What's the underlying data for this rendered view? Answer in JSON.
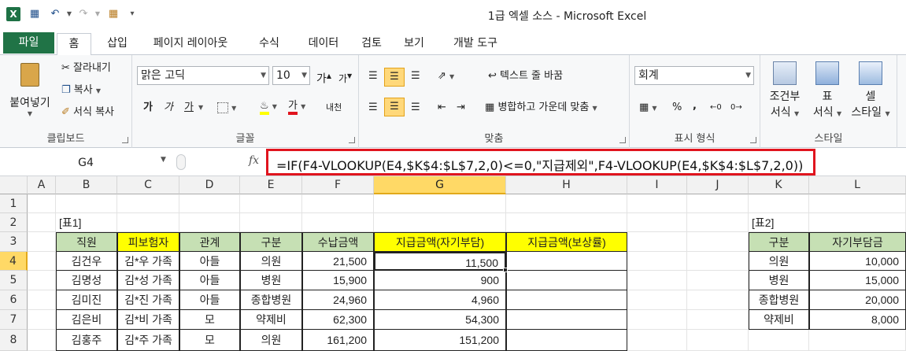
{
  "app": {
    "title": "1급 엑셀 소스 - Microsoft Excel"
  },
  "tabs": [
    {
      "label": "파일"
    },
    {
      "label": "홈"
    },
    {
      "label": "삽입"
    },
    {
      "label": "페이지 레이아웃"
    },
    {
      "label": "수식"
    },
    {
      "label": "데이터"
    },
    {
      "label": "검토"
    },
    {
      "label": "보기"
    },
    {
      "label": "개발 도구"
    }
  ],
  "ribbon": {
    "clipboard": {
      "paste": "붙여넣기",
      "cut": "잘라내기",
      "copy": "복사",
      "format_painter": "서식 복사",
      "label": "클립보드"
    },
    "font": {
      "name": "맑은 고딕",
      "size": "10",
      "bold": "가",
      "italic": "가",
      "underline": "가",
      "grow": "가",
      "shrink": "가",
      "color": "가",
      "phonetic": "내천",
      "label": "글꼴"
    },
    "alignment": {
      "wrap": "텍스트 줄 바꿈",
      "merge": "병합하고 가운데 맞춤",
      "label": "맞춤"
    },
    "number": {
      "format": "회계",
      "percent": "%",
      "comma": ",",
      "label": "표시 형식"
    },
    "styles": {
      "conditional": "조건부",
      "conditional2": "서식",
      "table": "표",
      "table2": "서식",
      "cell": "셀",
      "cell2": "스타일",
      "label": "스타일"
    }
  },
  "formula_bar": {
    "name_box": "G4",
    "fx": "fx",
    "formula": "=IF(F4-VLOOKUP(E4,$K$4:$L$7,2,0)<=0,\"지급제외\",F4-VLOOKUP(E4,$K$4:$L$7,2,0))"
  },
  "sheet": {
    "columns": [
      "A",
      "B",
      "C",
      "D",
      "E",
      "F",
      "G",
      "H",
      "I",
      "J",
      "K",
      "L"
    ],
    "rows": [
      "1",
      "2",
      "3",
      "4",
      "5",
      "6",
      "7",
      "8"
    ],
    "table1_title": "[표1]",
    "table2_title": "[표2]",
    "table1_headers": [
      "직원",
      "피보험자",
      "관계",
      "구분",
      "수납금액",
      "지급금액(자기부담)",
      "지급금액(보상률)"
    ],
    "table1_rows": [
      [
        "김건우",
        "김*우 가족",
        "아들",
        "의원",
        "21,500",
        "11,500",
        ""
      ],
      [
        "김명성",
        "김*성 가족",
        "아들",
        "병원",
        "15,900",
        "900",
        ""
      ],
      [
        "김미진",
        "김*진 가족",
        "아들",
        "종합병원",
        "24,960",
        "4,960",
        ""
      ],
      [
        "김은비",
        "김*비 가족",
        "모",
        "약제비",
        "62,300",
        "54,300",
        ""
      ],
      [
        "김홍주",
        "김*주 가족",
        "모",
        "의원",
        "161,200",
        "151,200",
        ""
      ]
    ],
    "table2_headers": [
      "구분",
      "자기부담금"
    ],
    "table2_rows": [
      [
        "의원",
        "10,000"
      ],
      [
        "병원",
        "15,000"
      ],
      [
        "종합병원",
        "20,000"
      ],
      [
        "약제비",
        "8,000"
      ]
    ]
  },
  "colors": {
    "excel_green": "#207346",
    "header_green": "#c6e0b4",
    "header_yellow": "#ffff00",
    "formula_highlight": "#e0141e",
    "selection": "#ffd966"
  }
}
